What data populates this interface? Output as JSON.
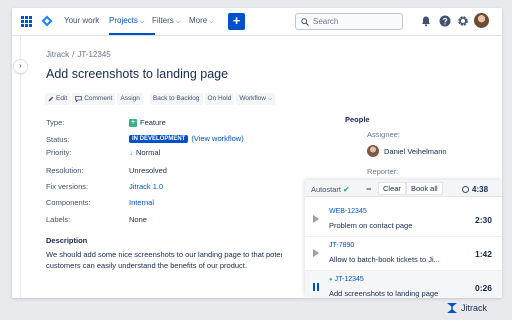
{
  "colors": {
    "accent": "#0052cc",
    "success": "#36b37e",
    "text": "#172b4d",
    "muted": "#6b778c"
  },
  "nav": {
    "your_work": "Your work",
    "projects": "Projects",
    "filters": "Filters",
    "more": "More",
    "create": "+",
    "search_placeholder": "Search"
  },
  "breadcrumb": {
    "project": "Jitrack",
    "separator": "/",
    "issue": "JT-12345"
  },
  "issue": {
    "title": "Add screenshots to landing page",
    "toolbar": {
      "edit": "Edit",
      "comment": "Comment",
      "assign": "Assign",
      "back_to_backlog": "Back to Backlog",
      "on_hold": "On Hold",
      "workflow": "Workflow"
    },
    "fields": {
      "type_label": "Type:",
      "type_value": "Feature",
      "status_label": "Status:",
      "status_value": "IN DEVELOPMENT",
      "view_workflow": "(View workflow)",
      "priority_label": "Priority:",
      "priority_value": "Normal",
      "resolution_label": "Resolution:",
      "resolution_value": "Unresolved",
      "fix_versions_label": "Fix versions:",
      "fix_versions_value": "Jitrack 1.0",
      "components_label": "Components:",
      "components_value": "Internal",
      "labels_label": "Labels:",
      "labels_value": "None"
    },
    "description": {
      "title": "Description",
      "line1": "We should add some nice screenshots to our landing page to that potenti",
      "line2": "customers can easily understand the benefits of our product."
    }
  },
  "people": {
    "title": "People",
    "assignee_label": "Assignee:",
    "assignee_name": "Daniel Veihelmann",
    "reporter_label": "Reporter:"
  },
  "jitrack": {
    "autostart": "Autostart",
    "autostart_check": "✔",
    "minus": "−",
    "clear": "Clear",
    "book_all": "Book all",
    "total_time": "4:38",
    "tasks": [
      {
        "key": "WEB-12345",
        "title": "Problem on contact page",
        "time": "2:30",
        "running": false
      },
      {
        "key": "JT-7890",
        "title": "Allow to batch-book tickets to Ji...",
        "time": "1:42",
        "running": false
      },
      {
        "key": "JT-12345",
        "title": "Add screenshots to landing page",
        "time": "0:26",
        "running": true
      }
    ]
  },
  "branding": {
    "name": "Jitrack"
  }
}
